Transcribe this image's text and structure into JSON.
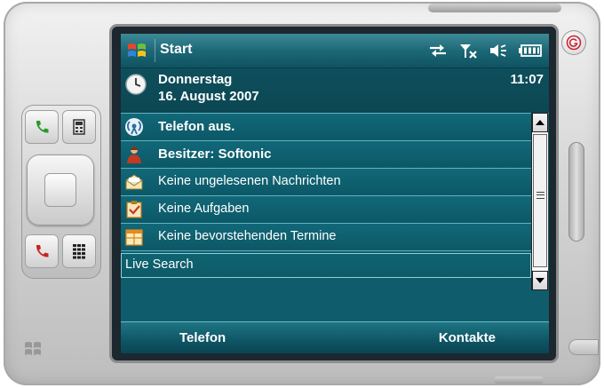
{
  "titlebar": {
    "title": "Start",
    "icons": [
      "windows-flag-icon",
      "sync-arrows-icon",
      "signal-off-icon",
      "speaker-icon",
      "battery-icon"
    ]
  },
  "today": {
    "date_weekday": "Donnerstag",
    "date_full": "16. August 2007",
    "time": "11:07",
    "items": [
      {
        "icon": "antenna-icon",
        "label": "Telefon aus."
      },
      {
        "icon": "owner-icon",
        "label": "Besitzer: Softonic"
      },
      {
        "icon": "mail-icon",
        "label": "Keine ungelesenen Nachrichten"
      },
      {
        "icon": "tasks-icon",
        "label": "Keine Aufgaben"
      },
      {
        "icon": "calendar-icon",
        "label": "Keine bevorstehenden Termine"
      }
    ],
    "search_label": "Live Search"
  },
  "softkeys": {
    "left": "Telefon",
    "right": "Kontakte"
  },
  "colors": {
    "screen": "#0f5d6c",
    "titlebar": "#1d6877",
    "separator": "#5fb3c0"
  }
}
